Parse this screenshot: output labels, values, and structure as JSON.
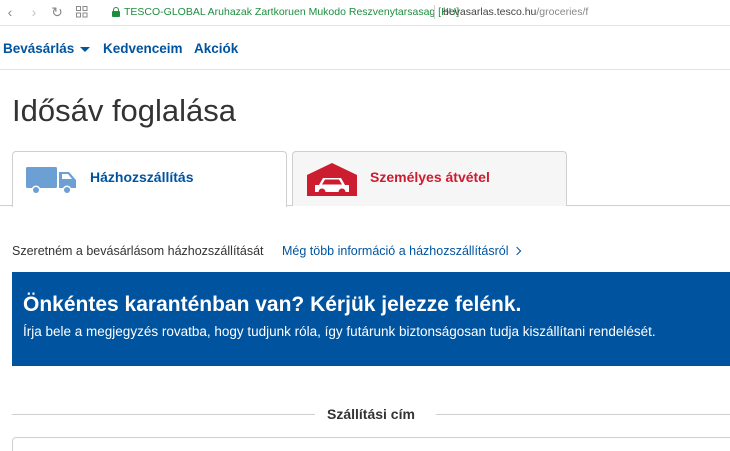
{
  "browser": {
    "certificate_owner": "TESCO-GLOBAL Aruhazak Zartkoruen Mukodo Reszvenytarsasag [HU]",
    "url_host": "bevasarlas.tesco.hu",
    "url_path": "/groceries/f"
  },
  "nav": {
    "shop": "Bevásárlás",
    "favourites": "Kedvenceim",
    "offers": "Akciók"
  },
  "page_title": "Idősáv foglalása",
  "tabs": [
    {
      "label": "Házhozszállítás",
      "icon": "delivery-truck-icon",
      "active": true
    },
    {
      "label": "Személyes átvétel",
      "icon": "click-and-collect-icon",
      "active": false
    }
  ],
  "info": {
    "text": "Szeretném a bevásárlásom házhozszállítását",
    "link": "Még több információ a házhozszállításról"
  },
  "banner": {
    "title": "Önkéntes karanténban van? Kérjük jelezze felénk.",
    "text": "Írja bele a megjegyzés rovatba, hogy tudjunk róla, így futárunk biztonságosan tudja kiszállítani rendelését."
  },
  "section": {
    "title": "Szállítási cím"
  },
  "colors": {
    "brand_blue": "#00539f",
    "brand_red": "#cc1c30",
    "secure_green": "#1e8e3e"
  }
}
